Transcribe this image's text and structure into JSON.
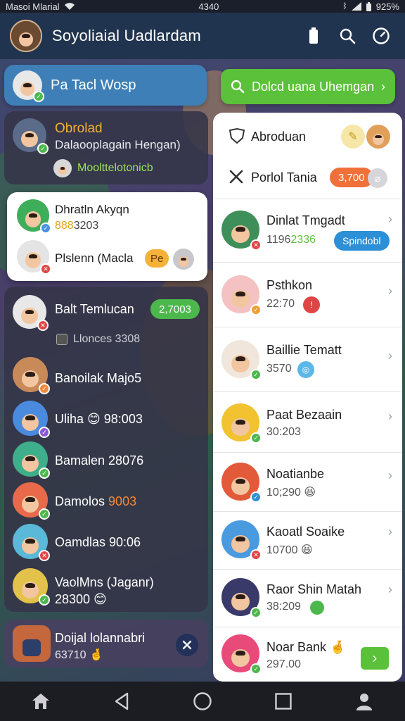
{
  "status_bar": {
    "carrier": "Masoi Mlarial",
    "time": "4340",
    "battery": "925%"
  },
  "header": {
    "title": "Soyoliaial Uadlardam"
  },
  "left": {
    "top_card": {
      "label": "Pa Tacl Wosp"
    },
    "group": {
      "name": "Obrolad",
      "subtitle": "Dalaooplagain Hengan)",
      "member": "Moolttelotonicb"
    },
    "selected": [
      {
        "name": "Dhratln Akyqn",
        "sub": "8803203",
        "name_prefix": "",
        "sub_highlight": "888"
      },
      {
        "name": "Plslenn (Macla",
        "pill": "Pe"
      }
    ],
    "contacts": [
      {
        "name": "Balt Temlucan",
        "pill": "2,7003",
        "sub": "Llonces 3308"
      },
      {
        "name": "Banoilak Majo5"
      },
      {
        "name": "Uliha 😊 98:003"
      },
      {
        "name": "Bamalen 28076"
      },
      {
        "name": "Damolos",
        "accent": "9003"
      },
      {
        "name": "Oamdlas 90:06"
      },
      {
        "name": "VaolMns (Jaganr)",
        "sub": "28300 😊"
      }
    ],
    "bottom_card": {
      "name": "Doijal lolannabri",
      "sub": "63710 🤞"
    }
  },
  "right": {
    "search_button": "Dolcd uana Uhemgan",
    "top": [
      {
        "label": "Abroduan"
      },
      {
        "label": "Porlol Tania",
        "pill": "3,700"
      }
    ],
    "items": [
      {
        "name": "Dinlat Tmgadt",
        "sub_prefix": "1196",
        "sub_accent": "2336",
        "pill": "Spindobl"
      },
      {
        "name": "Psthkon",
        "sub": "22:70"
      },
      {
        "name": "Baillie Tematt",
        "sub": "3570"
      },
      {
        "name": "Paat Bezaain",
        "sub": "30:203"
      },
      {
        "name": "Noatianbe",
        "sub": "10;290 😆"
      },
      {
        "name": "Kaoatl Soaike",
        "sub": "10700 😆"
      },
      {
        "name": "Raor Shin Matah",
        "sub": "38:209"
      },
      {
        "name": "Noar Bank 🤞",
        "sub": "297.00"
      }
    ]
  },
  "colors": {
    "accent_green": "#5cc13a",
    "accent_blue": "#2d8fd6",
    "accent_orange": "#f08a3a",
    "header_bg": "#21344f"
  },
  "nav": [
    "home-icon",
    "back-icon",
    "circle-home-icon",
    "recents-icon",
    "profile-icon"
  ]
}
